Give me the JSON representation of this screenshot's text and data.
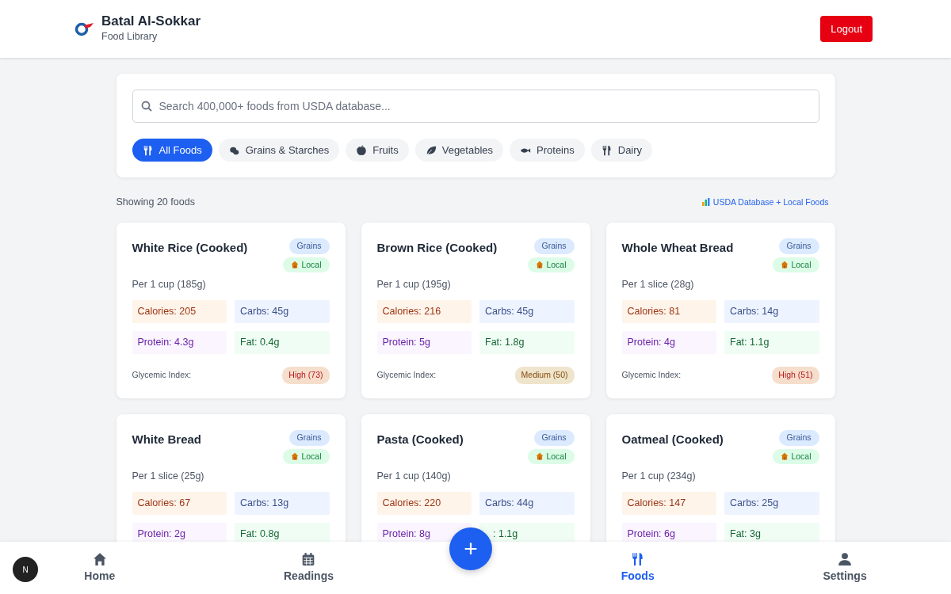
{
  "header": {
    "title": "Batal Al-Sokkar",
    "subtitle": "Food Library",
    "logout": "Logout"
  },
  "search": {
    "placeholder": "Search 400,000+ foods from USDA database..."
  },
  "categories": [
    {
      "label": "All Foods",
      "selected": true
    },
    {
      "label": "Grains & Starches",
      "selected": false
    },
    {
      "label": "Fruits",
      "selected": false
    },
    {
      "label": "Vegetables",
      "selected": false
    },
    {
      "label": "Proteins",
      "selected": false
    },
    {
      "label": "Dairy",
      "selected": false
    }
  ],
  "summary": {
    "count": "Showing 20 foods",
    "source": "USDA Database + Local Foods"
  },
  "foods": [
    {
      "name": "White Rice (Cooked)",
      "category": "Grains",
      "source": "Local",
      "serving": "Per 1 cup (185g)",
      "calories": "Calories: 205",
      "carbs": "Carbs: 45g",
      "protein": "Protein: 4.3g",
      "fat": "Fat: 0.4g",
      "gi_label": "Glycemic Index:",
      "gi": "High (73)",
      "color": "#b91c1c"
    },
    {
      "name": "Brown Rice (Cooked)",
      "category": "Grains",
      "source": "Local",
      "serving": "Per 1 cup (195g)",
      "calories": "Calories: 216",
      "carbs": "Carbs: 45g",
      "protein": "Protein: 5g",
      "fat": "Fat: 1.8g",
      "gi_label": "Glycemic Index:",
      "gi": "Medium (50)",
      "color": "#854d0e"
    },
    {
      "name": "Whole Wheat Bread",
      "category": "Grains",
      "source": "Local",
      "serving": "Per 1 slice (28g)",
      "calories": "Calories: 81",
      "carbs": "Carbs: 14g",
      "protein": "Protein: 4g",
      "fat": "Fat: 1.1g",
      "gi_label": "Glycemic Index:",
      "gi": "High (51)",
      "color": "#b91c1c"
    },
    {
      "name": "White Bread",
      "category": "Grains",
      "source": "Local",
      "serving": "Per 1 slice (25g)",
      "calories": "Calories: 67",
      "carbs": "Carbs: 13g",
      "protein": "Protein: 2g",
      "fat": "Fat: 0.8g"
    },
    {
      "name": "Pasta (Cooked)",
      "category": "Grains",
      "source": "Local",
      "serving": "Per 1 cup (140g)",
      "calories": "Calories: 220",
      "carbs": "Carbs: 44g",
      "protein": "Protein: 8g",
      "fat": ": 1.1g"
    },
    {
      "name": "Oatmeal (Cooked)",
      "category": "Grains",
      "source": "Local",
      "serving": "Per 1 cup (234g)",
      "calories": "Calories: 147",
      "carbs": "Carbs: 25g",
      "protein": "Protein: 6g",
      "fat": "Fat: 3g"
    }
  ],
  "fab": "+",
  "dev_badge": "N",
  "nav": [
    {
      "label": "Home",
      "selected": false
    },
    {
      "label": "Readings",
      "selected": false
    },
    {
      "label": "Foods",
      "selected": true
    },
    {
      "label": "Settings",
      "selected": false
    }
  ]
}
